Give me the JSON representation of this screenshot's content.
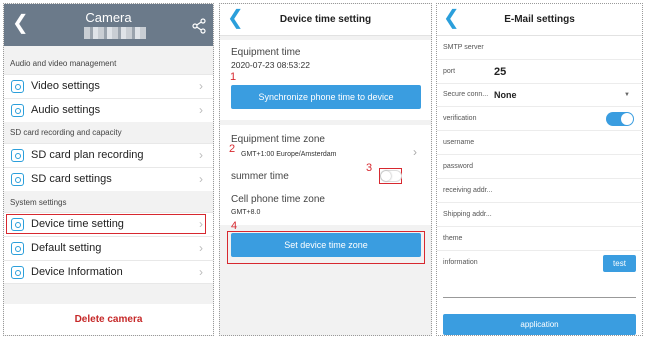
{
  "panel1": {
    "title": "Camera",
    "back_icon": "chevron-left-icon",
    "share_icon": "share-icon",
    "sections": [
      {
        "heading": "Audio and video management",
        "items": [
          {
            "label": "Video settings",
            "icon": "video-icon"
          },
          {
            "label": "Audio settings",
            "icon": "speaker-icon"
          }
        ]
      },
      {
        "heading": "SD card recording and capacity",
        "items": [
          {
            "label": "SD card plan recording",
            "icon": "camera-record-icon"
          },
          {
            "label": "SD card settings",
            "icon": "sd-card-icon"
          }
        ]
      },
      {
        "heading": "System settings",
        "items": [
          {
            "label": "Device time setting",
            "icon": "clock-icon"
          },
          {
            "label": "Default setting",
            "icon": "reset-icon"
          },
          {
            "label": "Device Information",
            "icon": "info-icon"
          }
        ]
      }
    ],
    "delete_label": "Delete camera"
  },
  "panel2": {
    "title": "Device time setting",
    "equipment_time_label": "Equipment time",
    "equipment_time_value": "2020-07-23 08:53:22",
    "sync_button": "Synchronize phone time to device",
    "timezone_label": "Equipment time zone",
    "timezone_value": "GMT+1:00 Europe/Amsterdam",
    "summer_time_label": "summer time",
    "cell_tz_label": "Cell phone time zone",
    "cell_tz_value": "GMT+8.0",
    "set_button": "Set device time zone",
    "markers": [
      "1",
      "2",
      "3",
      "4"
    ]
  },
  "panel3": {
    "title": "E-Mail settings",
    "rows": [
      {
        "label": "SMTP server",
        "value": ""
      },
      {
        "label": "port",
        "value": "25"
      },
      {
        "label": "Secure conn...",
        "value": "None"
      },
      {
        "label": "verification",
        "value": ""
      },
      {
        "label": "username",
        "value": ""
      },
      {
        "label": "password",
        "value": ""
      },
      {
        "label": "receiving addr...",
        "value": ""
      },
      {
        "label": "Shipping addr...",
        "value": ""
      },
      {
        "label": "theme",
        "value": ""
      },
      {
        "label": "information",
        "value": ""
      }
    ],
    "test_button": "test",
    "apply_button": "application"
  }
}
